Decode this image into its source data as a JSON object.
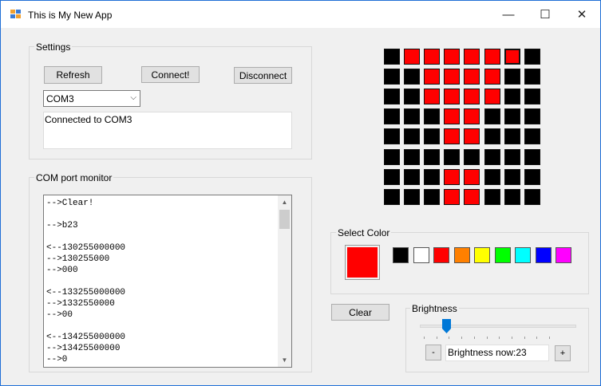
{
  "window": {
    "title": "This is My New App",
    "minimize": "—",
    "maximize": "☐",
    "close": "✕"
  },
  "settings": {
    "label": "Settings",
    "refresh_label": "Refresh",
    "connect_label": "Connect!",
    "disconnect_label": "Disconnect",
    "port_value": "COM3",
    "status_text": "Connected to COM3"
  },
  "monitor": {
    "label": "COM port monitor",
    "lines": [
      "-->Clear!",
      "",
      "-->b23",
      "",
      "<--130255000000",
      "-->130255000",
      "-->000",
      "",
      "<--133255000000",
      "-->1332550000",
      "-->00",
      "",
      "<--134255000000",
      "-->13425500000",
      "-->0"
    ]
  },
  "led_grid": {
    "rows": [
      [
        "black",
        "red",
        "red",
        "red",
        "red",
        "red",
        "red",
        "black"
      ],
      [
        "black",
        "black",
        "red",
        "red",
        "red",
        "red",
        "black",
        "black"
      ],
      [
        "black",
        "black",
        "red",
        "red",
        "red",
        "red",
        "black",
        "black"
      ],
      [
        "black",
        "black",
        "black",
        "red",
        "red",
        "black",
        "black",
        "black"
      ],
      [
        "black",
        "black",
        "black",
        "red",
        "red",
        "black",
        "black",
        "black"
      ],
      [
        "black",
        "black",
        "black",
        "black",
        "black",
        "black",
        "black",
        "black"
      ],
      [
        "black",
        "black",
        "black",
        "red",
        "red",
        "black",
        "black",
        "black"
      ],
      [
        "black",
        "black",
        "black",
        "red",
        "red",
        "black",
        "black",
        "black"
      ]
    ],
    "highlighted_cell": [
      0,
      6
    ]
  },
  "select_color": {
    "label": "Select Color",
    "selected": "#ff0000",
    "palette": [
      {
        "name": "black",
        "hex": "#000000"
      },
      {
        "name": "white",
        "hex": "#ffffff"
      },
      {
        "name": "red",
        "hex": "#ff0000"
      },
      {
        "name": "orange",
        "hex": "#ff8000"
      },
      {
        "name": "yellow",
        "hex": "#ffff00"
      },
      {
        "name": "green",
        "hex": "#00ff00"
      },
      {
        "name": "cyan",
        "hex": "#00ffff"
      },
      {
        "name": "blue",
        "hex": "#0000ff"
      },
      {
        "name": "magenta",
        "hex": "#ff00ff"
      }
    ]
  },
  "clear_label": "Clear",
  "brightness": {
    "label": "Brightness",
    "value": 23,
    "max": 255,
    "minus_label": "-",
    "plus_label": "+",
    "readout": "Brightness now:23"
  },
  "colors": {
    "red": "#ff0000",
    "black": "#000000",
    "accent": "#0078d7"
  }
}
